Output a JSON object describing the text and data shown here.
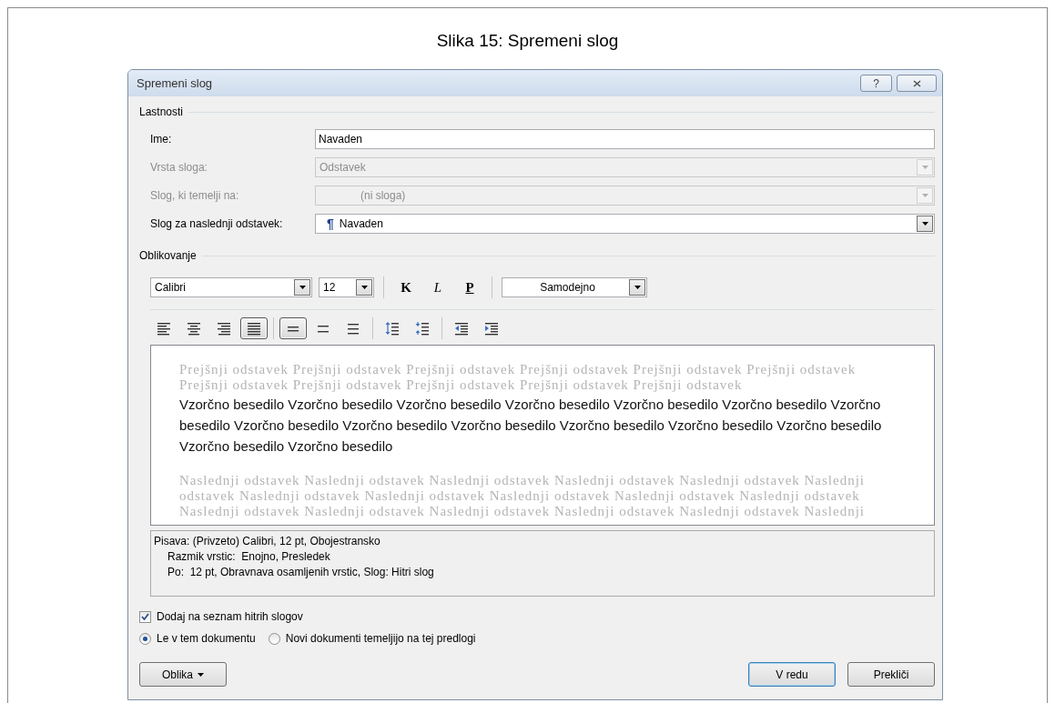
{
  "caption": "Slika 15: Spremeni slog",
  "window": {
    "title": "Spremeni slog",
    "help_button": "?"
  },
  "properties": {
    "title": "Lastnosti",
    "rows": [
      {
        "label": "Ime:",
        "kind": "text",
        "value": "Navaden",
        "disabled": false
      },
      {
        "label": "Vrsta sloga:",
        "kind": "dropdown",
        "value": "Odstavek",
        "disabled": true
      },
      {
        "label": "Slog, ki temelji na:",
        "kind": "dropdown",
        "value": "(ni sloga)",
        "disabled": true
      },
      {
        "label": "Slog za naslednji odstavek:",
        "kind": "dropdown",
        "value": "Navaden",
        "value_glyph": "¶",
        "disabled": false
      }
    ]
  },
  "formatting": {
    "title": "Oblikovanje",
    "font": "Calibri",
    "size": "12",
    "style_buttons": [
      {
        "label": "K",
        "kind": "bold"
      },
      {
        "label": "L",
        "kind": "italic"
      },
      {
        "label": "P",
        "kind": "underline"
      }
    ],
    "font_color": "Samodejno",
    "paragraph_toolbar": [
      [
        {
          "kind": "left",
          "selected": false
        },
        {
          "kind": "center",
          "selected": false
        },
        {
          "kind": "right",
          "selected": false
        },
        {
          "kind": "justify",
          "selected": true
        }
      ],
      [
        {
          "kind": "single",
          "selected": true
        },
        {
          "kind": "onehalf",
          "selected": false
        },
        {
          "kind": "double",
          "selected": false
        }
      ],
      [
        {
          "kind": "spaceup",
          "selected": false
        },
        {
          "kind": "spacedown",
          "selected": false
        }
      ],
      [
        {
          "kind": "outdent",
          "selected": false
        },
        {
          "kind": "indent",
          "selected": false
        }
      ]
    ]
  },
  "preview": {
    "previous": "Prejšnji odstavek Prejšnji odstavek Prejšnji odstavek Prejšnji odstavek Prejšnji odstavek Prejšnji odstavek Prejšnji odstavek Prejšnji odstavek Prejšnji odstavek Prejšnji odstavek Prejšnji odstavek",
    "sample": "Vzorčno besedilo Vzorčno besedilo Vzorčno besedilo Vzorčno besedilo Vzorčno besedilo Vzorčno besedilo Vzorčno besedilo Vzorčno besedilo Vzorčno besedilo Vzorčno besedilo Vzorčno besedilo Vzorčno besedilo Vzorčno besedilo Vzorčno besedilo Vzorčno besedilo",
    "next": "Naslednji odstavek Naslednji odstavek Naslednji odstavek Naslednji odstavek Naslednji odstavek Naslednji odstavek Naslednji odstavek Naslednji odstavek Naslednji odstavek Naslednji odstavek Naslednji odstavek Naslednji odstavek Naslednji odstavek Naslednji odstavek Naslednji odstavek Naslednji odstavek Naslednji"
  },
  "description": {
    "text": "Pisava: (Privzeto) Calibri, 12 pt, Obojestransko",
    "children": [
      {
        "text": "Razmik vrstic:  Enojno, Presledek"
      },
      {
        "text": "Po:  12 pt, Obravnava osamljenih vrstic, Slog: Hitri slog"
      }
    ]
  },
  "add_to_quick_styles": {
    "label": "Dodaj na seznam hitrih slogov",
    "checked": true
  },
  "scope": [
    {
      "label": "Le v tem dokumentu",
      "selected": true
    },
    {
      "label": "Novi dokumenti temeljijo na tej predlogi",
      "selected": false
    }
  ],
  "buttons": [
    {
      "label": "Oblika",
      "kind": "menu"
    },
    {
      "label": "V redu",
      "kind": "default"
    },
    {
      "label": "Prekliči",
      "kind": "normal"
    }
  ]
}
